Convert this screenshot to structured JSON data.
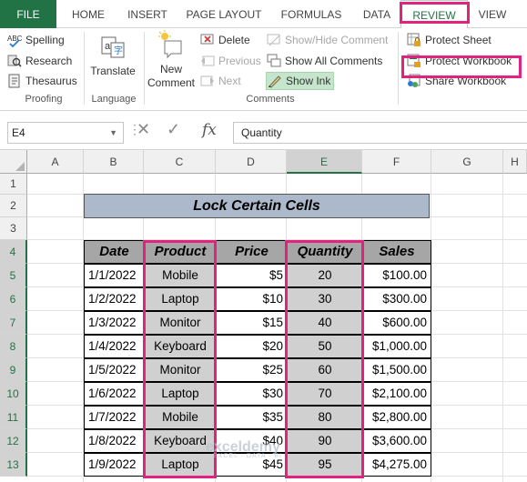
{
  "tabs": [
    "FILE",
    "HOME",
    "INSERT",
    "PAGE LAYOUT",
    "FORMULAS",
    "DATA",
    "REVIEW",
    "VIEW"
  ],
  "ribbon": {
    "proofing": {
      "spelling": "Spelling",
      "research": "Research",
      "thesaurus": "Thesaurus",
      "label": "Proofing"
    },
    "language": {
      "translate": "Translate",
      "label": "Language"
    },
    "comments": {
      "new_comment_line1": "New",
      "new_comment_line2": "Comment",
      "delete": "Delete",
      "previous": "Previous",
      "next": "Next",
      "show_hide": "Show/Hide Comment",
      "show_all": "Show All Comments",
      "show_ink": "Show Ink",
      "label": "Comments"
    },
    "changes": {
      "protect_sheet": "Protect Sheet",
      "protect_workbook": "Protect Workbook",
      "share_workbook": "Share Workbook"
    }
  },
  "formula_bar": {
    "name_box": "E4",
    "formula": "Quantity",
    "fx": "fx"
  },
  "sheet": {
    "columns": [
      "A",
      "B",
      "C",
      "D",
      "E",
      "F",
      "G",
      "H"
    ],
    "rows": [
      "1",
      "2",
      "3",
      "4",
      "5",
      "6",
      "7",
      "8",
      "9",
      "10",
      "11",
      "12",
      "13"
    ],
    "title": "Lock Certain Cells",
    "headers": [
      "Date",
      "Product",
      "Price",
      "Quantity",
      "Sales"
    ],
    "data": [
      [
        "1/1/2022",
        "Mobile",
        "$5",
        "20",
        "$100.00"
      ],
      [
        "1/2/2022",
        "Laptop",
        "$10",
        "30",
        "$300.00"
      ],
      [
        "1/3/2022",
        "Monitor",
        "$15",
        "40",
        "$600.00"
      ],
      [
        "1/4/2022",
        "Keyboard",
        "$20",
        "50",
        "$1,000.00"
      ],
      [
        "1/5/2022",
        "Monitor",
        "$25",
        "60",
        "$1,500.00"
      ],
      [
        "1/6/2022",
        "Laptop",
        "$30",
        "70",
        "$2,100.00"
      ],
      [
        "1/7/2022",
        "Mobile",
        "$35",
        "80",
        "$2,800.00"
      ],
      [
        "1/8/2022",
        "Keyboard",
        "$40",
        "90",
        "$3,600.00"
      ],
      [
        "1/9/2022",
        "Laptop",
        "$45",
        "95",
        "$4,275.00"
      ]
    ]
  },
  "watermark": {
    "name": "exceldemy",
    "tagline": "EXCEL · DATA · BI"
  },
  "colors": {
    "excel_green": "#217346",
    "highlight": "#e0237e",
    "title_fill": "#acb9ca",
    "header_fill": "#a6a6a6",
    "locked_fill": "#d0d0d0"
  }
}
